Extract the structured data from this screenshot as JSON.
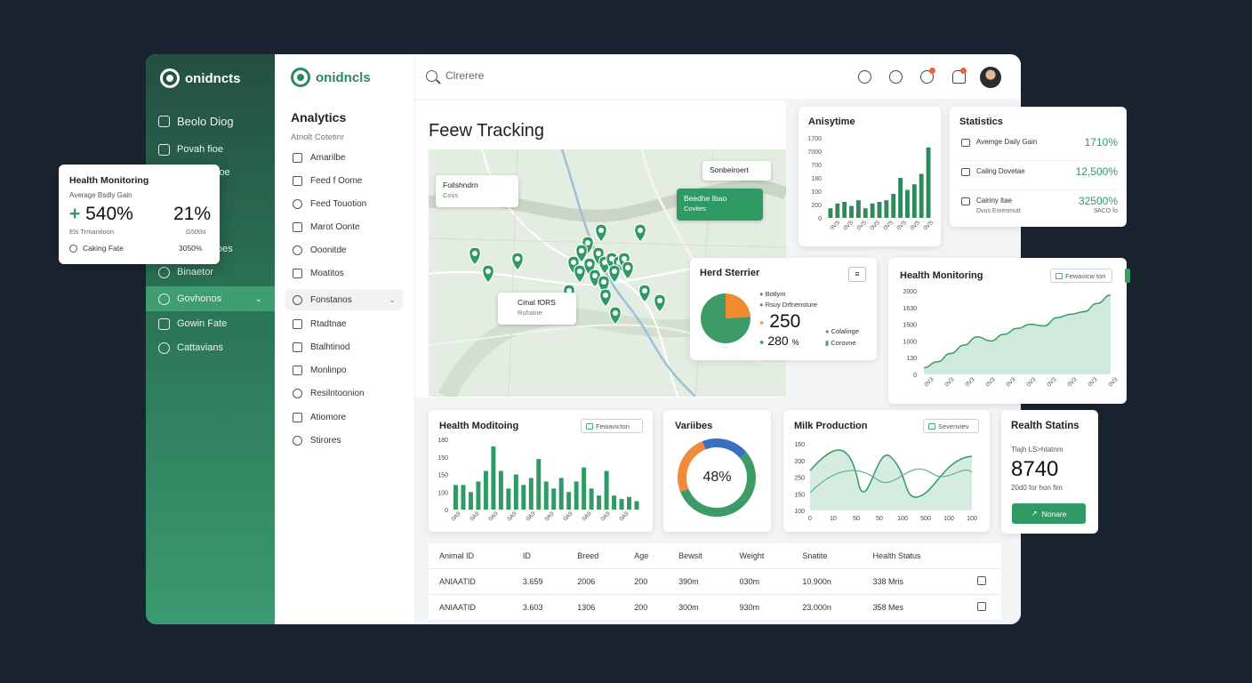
{
  "sidebar": {
    "brand": "onidncts",
    "items": [
      {
        "label": "Beolo Diog",
        "icon": "dashboard-icon"
      },
      {
        "label": "Povah fioe",
        "icon": "chart-icon"
      },
      {
        "label": "Binaetor",
        "icon": "target-icon"
      },
      {
        "label": "Govhonos",
        "icon": "settings-icon"
      },
      {
        "label": "Gowin Fate",
        "icon": "growth-icon"
      },
      {
        "label": "Cattavians",
        "icon": "check-icon"
      }
    ],
    "partial_labels": [
      "loe",
      "oes"
    ]
  },
  "nav2": {
    "brand": "onidncls",
    "title": "Analytics",
    "subtitle": "Atnolt Cotetinr",
    "items": [
      "Amarilbe",
      "Feed f Oome",
      "Feed Touotion",
      "Marot Oonte",
      "Ooonitde",
      "Moatitos",
      "Fonstanos",
      "Rtadtnae",
      "Btalhtinod",
      "Monlinpo",
      "Resilntoonion",
      "Atiomore",
      "Stirores"
    ]
  },
  "topbar": {
    "search_placeholder": "Clrerere"
  },
  "map": {
    "title": "Feew Tracking",
    "tag_top_left": {
      "title": "Foilshndrn",
      "sub": "Covs"
    },
    "tag_top_right": "Sonbeiroert",
    "tag_green": {
      "title": "Beedhe Ibao",
      "sub": "Covites"
    },
    "tag_bottom": {
      "title": "Cmal fORS",
      "sub": "Ruhaine"
    }
  },
  "float_card": {
    "title": "Health Monitoring",
    "sub1": "Average Bsdly Gain",
    "big_left": "+ 540%",
    "big_right": "21%",
    "sub2": "Els Trmanitoon",
    "sub2_right": "G500o",
    "row_label": "Caking Fate",
    "row_value": "3050%"
  },
  "anisytime": {
    "title": "Anisytime",
    "yticks": [
      "1700",
      "7000",
      "700",
      "180",
      "100",
      "200",
      "0"
    ],
    "bars": [
      0.12,
      0.18,
      0.2,
      0.15,
      0.22,
      0.12,
      0.18,
      0.2,
      0.22,
      0.3,
      0.5,
      0.35,
      0.42,
      0.55,
      0.88
    ]
  },
  "statistics": {
    "title": "Statistics",
    "rows": [
      {
        "label": "Avemge Daily Gain",
        "sub": "",
        "value": "1710%",
        "subvalue": "",
        "icon": "folder-icon"
      },
      {
        "label": "Caling Dovetae",
        "sub": "",
        "value": "12,500%",
        "subvalue": "",
        "icon": "cross-icon"
      },
      {
        "label": "Calriny ltae",
        "sub": "Dvus Emenmutt",
        "value": "32500%",
        "subvalue": "9ACO fo",
        "icon": "doc-icon"
      }
    ]
  },
  "herd": {
    "title": "Herd Sterrier",
    "legend_top": [
      "Botlym",
      "Rsuy Drfnensture"
    ],
    "big1": "250",
    "big2": "280",
    "big2_unit": "%",
    "legend_right": [
      "Colalinge",
      "Corovne"
    ],
    "pie": [
      {
        "value": 0.76,
        "color": "#3d9b67"
      },
      {
        "value": 0.24,
        "color": "#f08a2e"
      }
    ]
  },
  "health_monitoring_right": {
    "title": "Health Monitoring",
    "button": "Fewavicw ton",
    "yticks": [
      "2000",
      "1630",
      "1500",
      "1000",
      "130",
      "0"
    ],
    "values": [
      0.08,
      0.15,
      0.25,
      0.35,
      0.45,
      0.4,
      0.48,
      0.55,
      0.6,
      0.58,
      0.68,
      0.72,
      0.75,
      0.85,
      0.95
    ]
  },
  "health_moditoring": {
    "title": "Health Moditoing",
    "button": "Fewavicton",
    "yticks": [
      "180",
      "150",
      "150",
      "100",
      "0"
    ],
    "bars": [
      0.35,
      0.35,
      0.25,
      0.4,
      0.55,
      0.9,
      0.55,
      0.3,
      0.5,
      0.35,
      0.45,
      0.72,
      0.4,
      0.3,
      0.45,
      0.25,
      0.4,
      0.6,
      0.3,
      0.2,
      0.55,
      0.2,
      0.15,
      0.18,
      0.12
    ]
  },
  "variables": {
    "title": "Variibes",
    "center": "48%",
    "segments": [
      {
        "value": 0.55,
        "color": "#3d9b67"
      },
      {
        "value": 0.25,
        "color": "#ef8a3a"
      },
      {
        "value": 0.2,
        "color": "#3a6ec1"
      }
    ]
  },
  "milk": {
    "title": "Milk Production",
    "button": "Sevenviev",
    "yticks": [
      "160",
      "200",
      "250",
      "150",
      "100"
    ],
    "xticks": [
      "0",
      "10",
      "50",
      "50",
      "100",
      "500",
      "100",
      "100"
    ]
  },
  "realth": {
    "title": "Realth Statins",
    "sub": "Tlajh LS>htatnm",
    "value": "8740",
    "sub2": "20d0 for hon fim",
    "button": "Nonare"
  },
  "table": {
    "headers": [
      "Animal ID",
      "ID",
      "Breed",
      "Age",
      "Bewsit",
      "Weight",
      "Snatite",
      "Health Status",
      ""
    ],
    "rows": [
      [
        "ANIAATID",
        "3.659",
        "2006",
        "200",
        "390m",
        "030m",
        "10.900n",
        "338 Mris"
      ],
      [
        "ANIAATID",
        "3.603",
        "1306",
        "200",
        "300m",
        "930m",
        "23.000n",
        "358 Mes"
      ]
    ]
  },
  "colors": {
    "accent": "#2f9a63",
    "sidebar": "#2b7457",
    "orange": "#f08a2e"
  }
}
